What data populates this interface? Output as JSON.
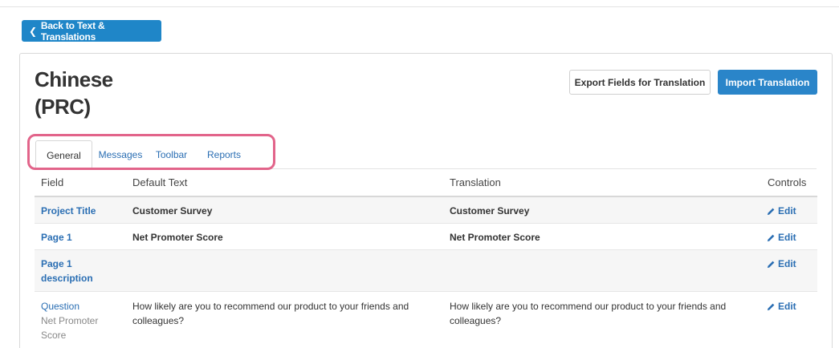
{
  "back_button": {
    "label": "Back to Text & Translations"
  },
  "page_title": "Chinese (PRC)",
  "actions": {
    "export_label": "Export Fields for Translation",
    "import_label": "Import Translation"
  },
  "tabs": [
    {
      "label": "General",
      "active": true
    },
    {
      "label": "Messages",
      "active": false
    },
    {
      "label": "Toolbar",
      "active": false
    },
    {
      "label": "Reports",
      "active": false
    }
  ],
  "table": {
    "headers": {
      "field": "Field",
      "default_text": "Default Text",
      "translation": "Translation",
      "controls": "Controls"
    },
    "edit_label": "Edit",
    "rows": [
      {
        "field": "Project Title",
        "field_sub": "",
        "default_text": "Customer Survey",
        "translation": "Customer Survey"
      },
      {
        "field": "Page 1",
        "field_sub": "",
        "default_text": "Net Promoter Score",
        "translation": "Net Promoter Score"
      },
      {
        "field": "Page 1 description",
        "field_sub": "",
        "default_text": "",
        "translation": ""
      },
      {
        "field": "Question",
        "field_sub": "Net Promoter Score",
        "default_text": "How likely are you to recommend our product to your friends and colleagues?",
        "translation": "How likely are you to recommend our product to your friends and colleagues?"
      }
    ]
  },
  "colors": {
    "primary": "#2a85c9",
    "link": "#2a6eb3",
    "highlight": "#e2648a"
  }
}
